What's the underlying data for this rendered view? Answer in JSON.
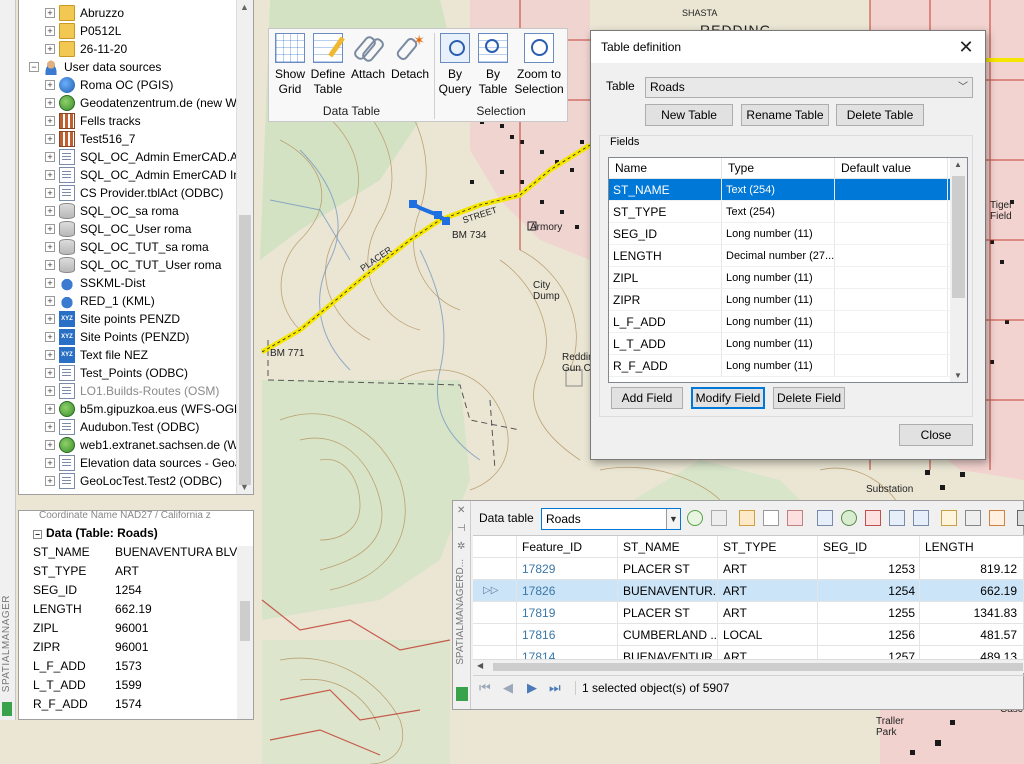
{
  "tree": {
    "items": [
      {
        "label": "Abruzzo",
        "icon": "folder-icon",
        "level": 2
      },
      {
        "label": "P0512L",
        "icon": "folder-icon",
        "level": 2
      },
      {
        "label": "26-11-20",
        "icon": "folder-icon",
        "level": 2
      },
      {
        "label": "User data sources",
        "icon": "user-icon",
        "level": 1
      },
      {
        "label": "Roma OC (PGIS)",
        "icon": "elephant-icon",
        "level": 2
      },
      {
        "label": "Geodatenzentrum.de (new W",
        "icon": "wfs-globe-icon",
        "level": 2
      },
      {
        "label": "Fells tracks",
        "icon": "tracks-icon",
        "level": 2
      },
      {
        "label": "Test516_7",
        "icon": "tracks-icon",
        "level": 2
      },
      {
        "label": "SQL_OC_Admin EmerCAD.Ac",
        "icon": "document-icon",
        "level": 2
      },
      {
        "label": "SQL_OC_Admin EmerCAD In",
        "icon": "document-icon",
        "level": 2
      },
      {
        "label": "CS Provider.tblAct (ODBC)",
        "icon": "document-icon",
        "level": 2
      },
      {
        "label": "SQL_OC_sa roma",
        "icon": "database-icon",
        "level": 2
      },
      {
        "label": "SQL_OC_User roma",
        "icon": "database-icon",
        "level": 2
      },
      {
        "label": "SQL_OC_TUT_sa roma",
        "icon": "database-icon",
        "level": 2
      },
      {
        "label": "SQL_OC_TUT_User roma",
        "icon": "database-icon",
        "level": 2
      },
      {
        "label": "SSKML-Dist",
        "icon": "kml-icon",
        "level": 2
      },
      {
        "label": "RED_1 (KML)",
        "icon": "kml-icon",
        "level": 2
      },
      {
        "label": "Site points PENZD",
        "icon": "xyz-icon",
        "level": 2
      },
      {
        "label": "Site Points (PENZD)",
        "icon": "xyz-icon",
        "level": 2
      },
      {
        "label": "Text file NEZ",
        "icon": "xyz-icon",
        "level": 2
      },
      {
        "label": "Test_Points (ODBC)",
        "icon": "document-icon",
        "level": 2
      },
      {
        "label": "LO1.Builds-Routes (OSM)",
        "icon": "document-icon",
        "level": 2,
        "dim": true
      },
      {
        "label": "b5m.gipuzkoa.eus (WFS-OGR",
        "icon": "wfs-globe-icon",
        "level": 2
      },
      {
        "label": "Audubon.Test (ODBC)",
        "icon": "document-icon",
        "level": 2
      },
      {
        "label": "web1.extranet.sachsen.de (W",
        "icon": "wfs-globe-icon",
        "level": 2
      },
      {
        "label": "Elevation data sources - GeoJ",
        "icon": "document-icon",
        "level": 2
      },
      {
        "label": "GeoLocTest.Test2 (ODBC)",
        "icon": "document-icon",
        "level": 2
      }
    ]
  },
  "data_panel": {
    "cut_header": "Coordinate Name  NAD27 / California z",
    "title": "Data (Table: Roads)",
    "rows": [
      {
        "k": "ST_NAME",
        "v": "BUENAVENTURA BLV"
      },
      {
        "k": "ST_TYPE",
        "v": "ART"
      },
      {
        "k": "SEG_ID",
        "v": "1254"
      },
      {
        "k": "LENGTH",
        "v": "662.19"
      },
      {
        "k": "ZIPL",
        "v": "96001"
      },
      {
        "k": "ZIPR",
        "v": "96001"
      },
      {
        "k": "L_F_ADD",
        "v": "1573"
      },
      {
        "k": "L_T_ADD",
        "v": "1599"
      },
      {
        "k": "R_F_ADD",
        "v": "1574"
      }
    ]
  },
  "side_label": "SPATIALMANAGER",
  "ribbon": {
    "buttons": [
      {
        "l1": "Show",
        "l2": "Grid"
      },
      {
        "l1": "Define",
        "l2": "Table"
      },
      {
        "l1": "Attach",
        "l2": ""
      },
      {
        "l1": "Detach",
        "l2": ""
      },
      {
        "l1": "By",
        "l2": "Query"
      },
      {
        "l1": "By",
        "l2": "Table"
      },
      {
        "l1": "Zoom to",
        "l2": "Selection"
      }
    ],
    "group_data_table": "Data Table",
    "group_selection": "Selection"
  },
  "dialog": {
    "title": "Table definition",
    "table_label": "Table",
    "table_value": "Roads",
    "new_table": "New Table",
    "rename_table": "Rename Table",
    "delete_table": "Delete Table",
    "fields_label": "Fields",
    "columns": [
      "Name",
      "Type",
      "Default value"
    ],
    "fields": [
      {
        "name": "ST_NAME",
        "type": "Text (254)",
        "def": ""
      },
      {
        "name": "ST_TYPE",
        "type": "Text (254)",
        "def": ""
      },
      {
        "name": "SEG_ID",
        "type": "Long number (11)",
        "def": ""
      },
      {
        "name": "LENGTH",
        "type": "Decimal number (27...",
        "def": ""
      },
      {
        "name": "ZIPL",
        "type": "Long number (11)",
        "def": ""
      },
      {
        "name": "ZIPR",
        "type": "Long number (11)",
        "def": ""
      },
      {
        "name": "L_F_ADD",
        "type": "Long number (11)",
        "def": ""
      },
      {
        "name": "L_T_ADD",
        "type": "Long number (11)",
        "def": ""
      },
      {
        "name": "R_F_ADD",
        "type": "Long number (11)",
        "def": ""
      }
    ],
    "add_field": "Add Field",
    "modify_field": "Modify Field",
    "delete_field": "Delete Field",
    "close": "Close"
  },
  "data_table": {
    "label": "Data table",
    "table_value": "Roads",
    "side_label": "SPATIALMANAGERD...",
    "columns": [
      "Feature_ID",
      "ST_NAME",
      "ST_TYPE",
      "SEG_ID",
      "LENGTH"
    ],
    "rows": [
      {
        "fid": "17829",
        "st": "PLACER ST",
        "tp": "ART",
        "seg": "1253",
        "len": "819.12",
        "ind": ""
      },
      {
        "fid": "17826",
        "st": "BUENAVENTUR...",
        "tp": "ART",
        "seg": "1254",
        "len": "662.19",
        "ind": "▷▷"
      },
      {
        "fid": "17819",
        "st": "PLACER ST",
        "tp": "ART",
        "seg": "1255",
        "len": "1341.83",
        "ind": ""
      },
      {
        "fid": "17816",
        "st": "CUMBERLAND ...",
        "tp": "LOCAL",
        "seg": "1256",
        "len": "481.57",
        "ind": ""
      },
      {
        "fid": "17814",
        "st": "BUENAVENTUR...",
        "tp": "ART",
        "seg": "1257",
        "len": "489.13",
        "ind": ""
      }
    ],
    "status": "1 selected object(s) of 5907"
  },
  "map_labels": {
    "redding": "REDDING",
    "shasta": "SHASTA",
    "street": "STREET",
    "bm734": "BM 734",
    "armory": "Armory",
    "placer": "PLACER",
    "city_dump": "City Dump",
    "redding_gun": "Redding Gun C",
    "bm771": "BM 771",
    "substation": "Substation",
    "tiger_field": "Tiger Field",
    "traller_park": "Traller Park",
    "casc": "Casc"
  },
  "colors": {
    "accent": "#0078d7",
    "road": "#f5e600",
    "selection": "#1f6fe0"
  }
}
